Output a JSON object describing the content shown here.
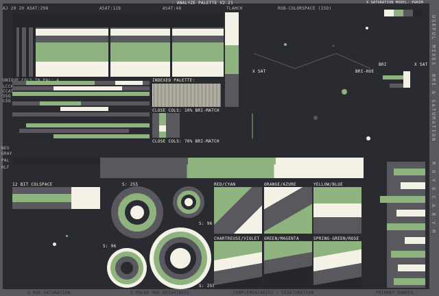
{
  "header": {
    "title": "- ANALYZE PALETTE V2.21 -",
    "label_a": "AJ 29 20 ASAT:298",
    "label_b": "ASAT:128",
    "label_c": "ASAT:48",
    "label_d": "TLAHCH",
    "colorspace": "RGB-COLORSPACE (ISO)",
    "saturation_model": "X SATURATION MODEL: PURIM"
  },
  "left": {
    "unique_cols": "UNIQUE COLS IN PAL: 4",
    "row_labels": [
      "LCCH",
      "CCAT",
      "SSQ",
      "LSQ"
    ],
    "side_labels": [
      "NEU",
      "GRAY",
      "PAL",
      "HLF"
    ],
    "indexed_palette": "INDEXED PALETTE:",
    "close_cols_1": "CLOSE COLS: 10% BRI-MATCH",
    "close_cols_2": "CLOSE COLS: 70% BRI-MATCH",
    "bit_colspace": "12 BIT COLSPACE"
  },
  "rgb": {
    "sat_left": "X SAT",
    "bri_hue": "BRI-HUE",
    "bri": "BRI",
    "sat_right": "X SAT"
  },
  "polar": {
    "s255a": "S: 255",
    "s96a": "S: 96",
    "s96b": "S: 96",
    "s255b": "S: 255"
  },
  "complements": {
    "labels": [
      "RED/CYAN",
      "ORANGE/AZURE",
      "YELLOW/BLUE",
      "CHARTREUSE/VIOLET",
      "GREEN/MAGENTA",
      "SPRING-GREEN/ROSE"
    ]
  },
  "footer": {
    "hue_sat": "X HUE-SATURATION",
    "polar": "X POLAR HUE-BRIGHTNESS",
    "complementaries": "COMPLEMENTARIES / DESATURATION",
    "primary_ranges": "PRIMARY RANGES"
  },
  "right_side": {
    "useful_mixes": "USEFUL MIXES",
    "bri_sat": "BRI & SATURATION",
    "rgb_letters": "R O Y G C A B V M"
  },
  "colors": {
    "background": "#2a2b30",
    "dark": "#26272b",
    "grey": "#5a585f",
    "green": "#8fb37e",
    "cream": "#f4f2e6"
  }
}
